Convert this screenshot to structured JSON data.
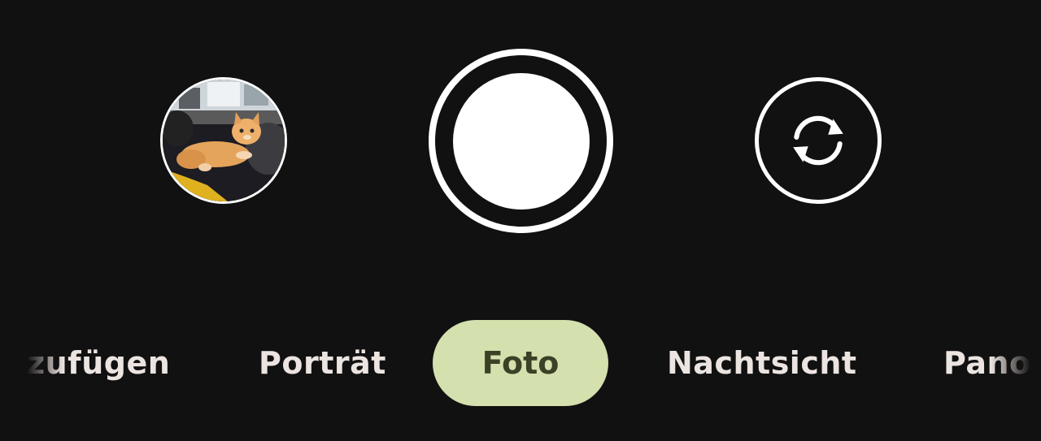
{
  "controls": {
    "gallery_thumbnail": {
      "icon": "gallery-thumbnail-photo",
      "subject": "kitten"
    },
    "shutter": {
      "icon": "shutter-icon"
    },
    "switch_camera": {
      "icon": "camera-switch-icon"
    }
  },
  "modes": {
    "items": [
      {
        "label": "zufügen"
      },
      {
        "label": "Porträt"
      },
      {
        "label": "Foto"
      },
      {
        "label": "Nachtsicht"
      },
      {
        "label": "Pano"
      }
    ],
    "selected": "Foto"
  },
  "colors": {
    "background": "#111111",
    "active_pill": "#d4e0ad",
    "active_text": "#3a4127",
    "mode_text": "#ece4e0",
    "icon": "#ffffff"
  }
}
